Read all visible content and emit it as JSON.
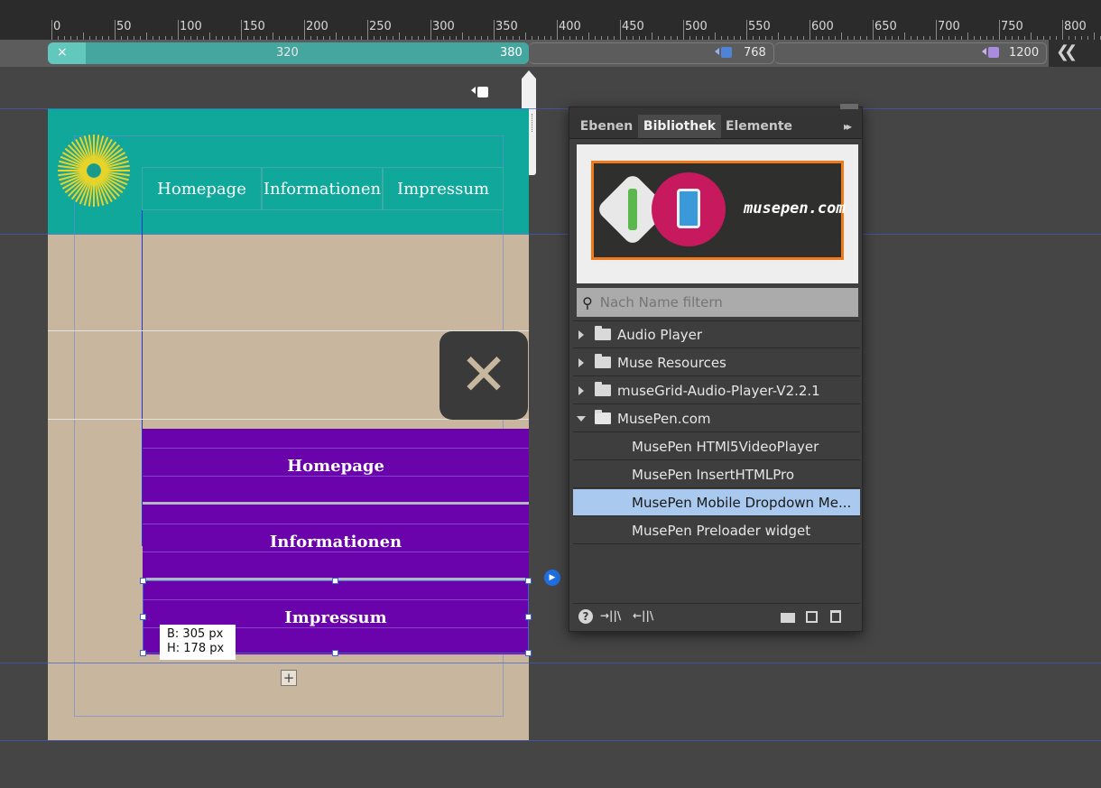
{
  "ruler": {
    "labels": [
      "0",
      "50",
      "100",
      "150",
      "200",
      "250",
      "300",
      "350",
      "400",
      "450",
      "500",
      "550",
      "600",
      "650",
      "700",
      "750",
      "800"
    ]
  },
  "breakpoints": {
    "close_glyph": "×",
    "current_min": "320",
    "current_max": "380",
    "bp2": "768",
    "bp3": "1200",
    "collapse_glyph": "❮❮",
    "colors": {
      "active": "#45a6a0",
      "bp2_marker": "#4f83d6",
      "bp3_marker": "#a98be0"
    }
  },
  "page": {
    "nav": [
      "Homepage",
      "Informationen",
      "Impressum"
    ],
    "close_glyph": "✕",
    "menu_items": [
      "Homepage",
      "Informationen",
      "Impressum"
    ],
    "size_tooltip": {
      "width": "B: 305 px",
      "height": "H: 178 px"
    },
    "add_glyph": "+",
    "colors": {
      "header": "#0fa89b",
      "body": "#c8b79e",
      "menu": "#6a03ab"
    }
  },
  "panel": {
    "tabs": [
      "Ebenen",
      "Bibliothek",
      "Elemente"
    ],
    "menu_glyph": "▸▸",
    "banner_text": "musepen.com",
    "search_placeholder": "Nach Name filtern",
    "folders": [
      {
        "label": "Audio Player",
        "expanded": false
      },
      {
        "label": "Muse Resources",
        "expanded": false
      },
      {
        "label": "museGrid-Audio-Player-V2.2.1",
        "expanded": false
      },
      {
        "label": "MusePen.com",
        "expanded": true
      }
    ],
    "items": [
      {
        "label": "MusePen HTMl5VideoPlayer",
        "selected": false
      },
      {
        "label": "MusePen InsertHTMLPro",
        "selected": false
      },
      {
        "label": "MusePen Mobile Dropdown Me...",
        "selected": true
      },
      {
        "label": "MusePen Preloader widget",
        "selected": false
      }
    ],
    "footer": {
      "help": "?",
      "import": "→||\\",
      "export": "←||\\"
    }
  }
}
